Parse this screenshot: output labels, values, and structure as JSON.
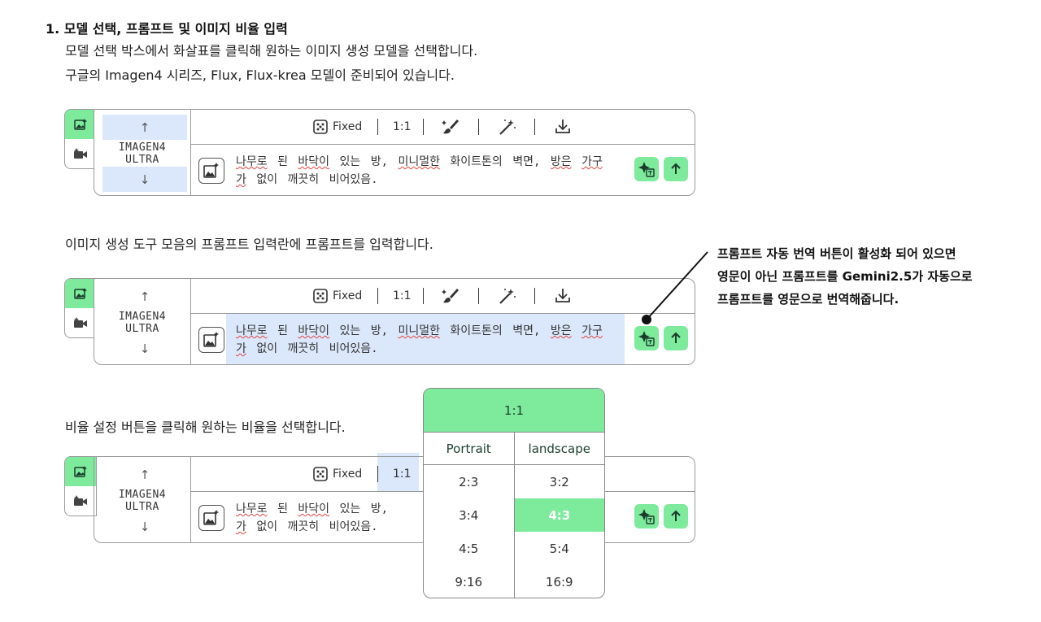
{
  "heading": "1. 모델 선택, 프롬프트 및 이미지 비율 입력",
  "paragraphs": {
    "p1": "모델 선택 박스에서 화살표를 클릭해 원하는 이미지 생성 모델을 선택합니다.",
    "p2": "구글의 Imagen4 시리즈, Flux, Flux-krea 모델이 준비되어 있습니다.",
    "p3": "이미지 생성 도구 모음의 프롬프트 입력란에 프롬프트를 입력합니다.",
    "p4": "비율 설정 버튼을 클릭해 원하는 비율을 선택합니다."
  },
  "panel": {
    "model_line1": "IMAGEN4",
    "model_line2": "ULTRA",
    "seed_label": "Fixed",
    "ratio_label": "1:1",
    "prompt_line1_words": [
      "나무로",
      "된",
      "바닥이",
      "있는",
      "방,",
      "미니멀한",
      "화이트톤의",
      "벽면,",
      "방은",
      "가구"
    ],
    "prompt_line2_words": [
      "가",
      "없이",
      "깨끗히",
      "비어있음."
    ]
  },
  "callout": {
    "line1": "프롬프트 자동 번역 버튼이 활성화 되어 있으면",
    "line2": "영문이 아닌 프롬프트를 Gemini2.5가 자동으로",
    "line3": "프롬프트를 영문으로 번역해줍니다."
  },
  "ratio_menu": {
    "current": "1:1",
    "portrait_label": "Portrait",
    "landscape_label": "landscape",
    "portrait": [
      "2:3",
      "3:4",
      "4:5",
      "9:16"
    ],
    "landscape": [
      "3:2",
      "4:3",
      "5:4",
      "16:9"
    ],
    "selected": "4:3"
  },
  "colors": {
    "accent_green": "#7dea9c",
    "highlight_blue": "#dbe8fb",
    "border": "#9a9a9a"
  }
}
